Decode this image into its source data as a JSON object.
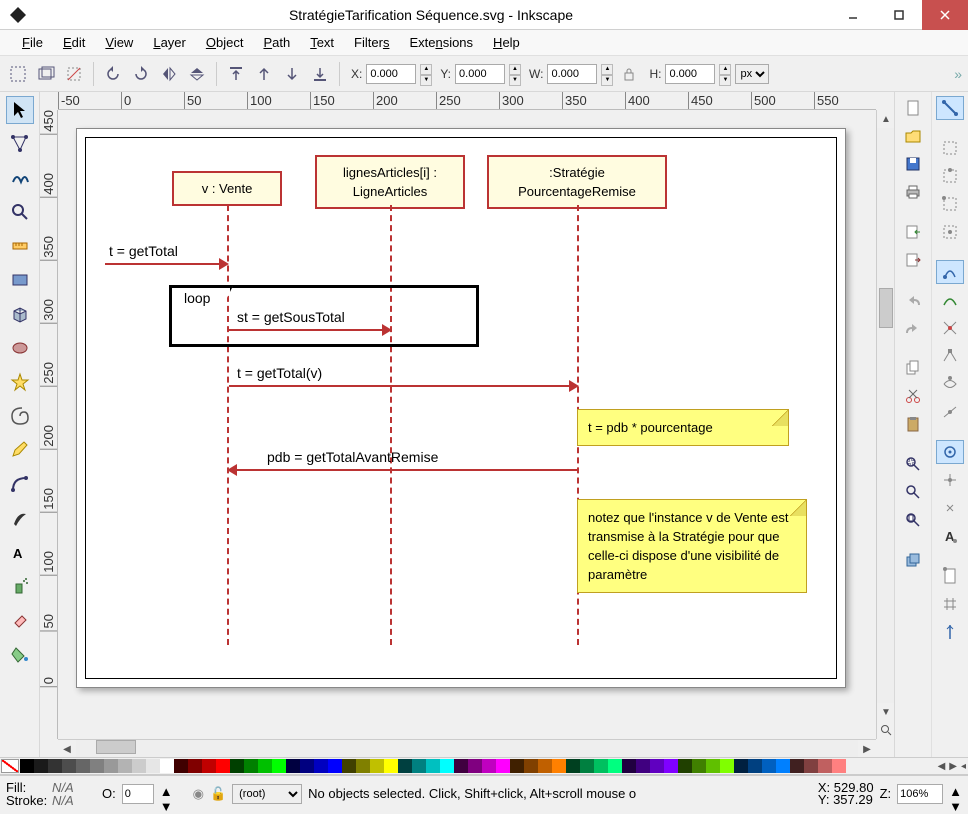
{
  "window": {
    "title": "StratégieTarification Séquence.svg - Inkscape"
  },
  "menu": {
    "file": "File",
    "edit": "Edit",
    "view": "View",
    "layer": "Layer",
    "object": "Object",
    "path": "Path",
    "text": "Text",
    "filters": "Filters",
    "extensions": "Extensions",
    "help": "Help"
  },
  "toolbar": {
    "x_label": "X:",
    "x_value": "0.000",
    "y_label": "Y:",
    "y_value": "0.000",
    "w_label": "W:",
    "w_value": "0.000",
    "h_label": "H:",
    "h_value": "0.000",
    "unit": "px"
  },
  "ruler_h": [
    "-50",
    "0",
    "50",
    "100",
    "150",
    "200",
    "250",
    "300",
    "350",
    "400",
    "450",
    "500",
    "550"
  ],
  "ruler_v": [
    "450",
    "400",
    "350",
    "300",
    "250",
    "200",
    "150",
    "100",
    "50",
    "0"
  ],
  "uml": {
    "box1": "v : Vente",
    "box2_l1": "lignesArticles[i] :",
    "box2_l2": "LigneArticles",
    "box3_l1": ":Stratégie",
    "box3_l2": "PourcentageRemise",
    "loop_label": "loop",
    "msg1": "t = getTotal",
    "msg2": "st = getSousTotal",
    "msg3": "t = getTotal(v)",
    "msg4": "pdb = getTotalAvantRemise",
    "note1": "t = pdb * pourcentage",
    "note2": "notez que l'instance v de Vente est transmise à la Stratégie pour que celle-ci dispose d'une visibilité de paramètre"
  },
  "palette": [
    "#000000",
    "#1a1a1a",
    "#333333",
    "#4d4d4d",
    "#666666",
    "#808080",
    "#999999",
    "#b3b3b3",
    "#cccccc",
    "#e6e6e6",
    "#ffffff",
    "#400000",
    "#800000",
    "#c00000",
    "#ff0000",
    "#004000",
    "#008000",
    "#00c000",
    "#00ff00",
    "#000040",
    "#000080",
    "#0000c0",
    "#0000ff",
    "#404000",
    "#808000",
    "#c0c000",
    "#ffff00",
    "#004040",
    "#008080",
    "#00c0c0",
    "#00ffff",
    "#400040",
    "#800080",
    "#c000c0",
    "#ff00ff",
    "#402000",
    "#804000",
    "#c06000",
    "#ff8000",
    "#004020",
    "#008040",
    "#00c060",
    "#00ff80",
    "#200040",
    "#400080",
    "#6000c0",
    "#8000ff",
    "#204000",
    "#408000",
    "#60c000",
    "#80ff00",
    "#002040",
    "#004080",
    "#0060c0",
    "#0080ff",
    "#402020",
    "#804040",
    "#c06060",
    "#ff8080"
  ],
  "status": {
    "fill_label": "Fill:",
    "fill_value": "N/A",
    "stroke_label": "Stroke:",
    "stroke_value": "N/A",
    "opacity_label": "O:",
    "opacity_value": "0",
    "layer_value": "(root)",
    "message": "No objects selected. Click, Shift+click, Alt+scroll mouse o",
    "x_label": "X:",
    "x_value": "529.80",
    "y_label": "Y:",
    "y_value": "357.29",
    "zoom_label": "Z:",
    "zoom_value": "106%"
  }
}
